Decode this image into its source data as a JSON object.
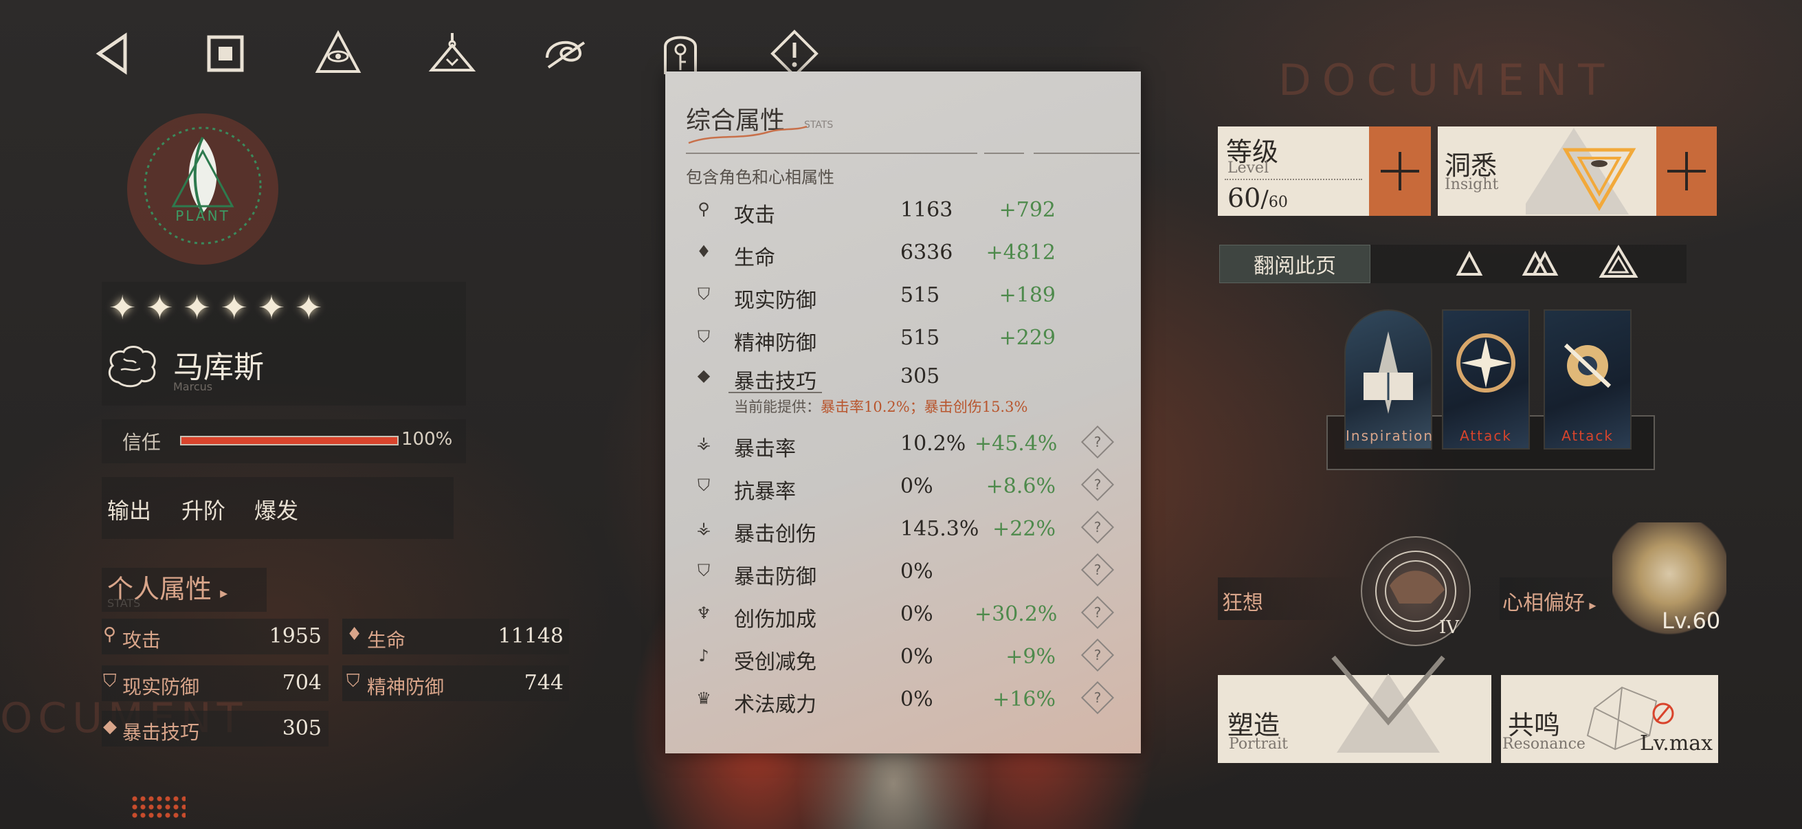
{
  "background": {
    "watermark_right": "DOCUMENT",
    "watermark_left": "OCUMENT"
  },
  "nav": {
    "icons": [
      "back-triangle-icon",
      "stop-square-icon",
      "eye-triangle-icon",
      "flask-icon",
      "swirl-icon",
      "key-door-icon",
      "warning-diamond-icon"
    ]
  },
  "character": {
    "stars": "✦✦✦✦✦✦",
    "name": "马库斯",
    "name_en": "Marcus",
    "afflatus": "PLANT",
    "trust_label": "信任",
    "trust_value": "100%",
    "trust_fraction": 1.0,
    "tags": [
      "输出",
      "升阶",
      "爆发"
    ]
  },
  "personal": {
    "title": "个人属性",
    "title_en": "STATS",
    "stats": [
      {
        "label": "攻击",
        "value": "1955",
        "icon": "attack-icon"
      },
      {
        "label": "生命",
        "value": "11148",
        "icon": "health-icon"
      },
      {
        "label": "现实防御",
        "value": "704",
        "icon": "reality-def-icon"
      },
      {
        "label": "精神防御",
        "value": "744",
        "icon": "mental-def-icon"
      },
      {
        "label": "暴击技巧",
        "value": "305",
        "icon": "crit-tech-icon"
      }
    ]
  },
  "stats_popup": {
    "title": "综合属性",
    "title_en": "STATS",
    "desc": "包含角色和心相属性",
    "rows": [
      {
        "label": "攻击",
        "base": "1163",
        "bonus": "+792",
        "help": false
      },
      {
        "label": "生命",
        "base": "6336",
        "bonus": "+4812",
        "help": false
      },
      {
        "label": "现实防御",
        "base": "515",
        "bonus": "+189",
        "help": false
      },
      {
        "label": "精神防御",
        "base": "515",
        "bonus": "+229",
        "help": false
      },
      {
        "label": "暴击技巧",
        "base": "305",
        "bonus": "",
        "help": false
      },
      {
        "label": "暴击率",
        "base": "10.2%",
        "bonus": "+45.4%",
        "help": true
      },
      {
        "label": "抗暴率",
        "base": "0%",
        "bonus": "+8.6%",
        "help": true
      },
      {
        "label": "暴击创伤",
        "base": "145.3%",
        "bonus": "+22%",
        "help": true
      },
      {
        "label": "暴击防御",
        "base": "0%",
        "bonus": "",
        "help": true
      },
      {
        "label": "创伤加成",
        "base": "0%",
        "bonus": "+30.2%",
        "help": true
      },
      {
        "label": "受创减免",
        "base": "0%",
        "bonus": "+9%",
        "help": true
      },
      {
        "label": "术法威力",
        "base": "0%",
        "bonus": "+16%",
        "help": true
      }
    ],
    "crit_note_prefix": "当前能提供：",
    "crit_note_value": "暴击率10.2%；暴击创伤15.3%",
    "help_symbol": "?"
  },
  "level": {
    "label": "等级",
    "label_en": "Level",
    "current": "60",
    "max": "60",
    "separator": "/"
  },
  "insight": {
    "label": "洞悉",
    "label_en": "Insight"
  },
  "browse": {
    "label": "翻阅此页"
  },
  "tarot": {
    "labels": [
      "Inspiration",
      "Attack",
      "Attack"
    ]
  },
  "kuangxiang": {
    "label": "狂想",
    "level": "IV"
  },
  "xinxiang": {
    "label": "心相偏好",
    "level": "Lv.60"
  },
  "portrait": {
    "label": "塑造",
    "label_en": "Portrait"
  },
  "resonance": {
    "label": "共鸣",
    "label_en": "Resonance",
    "level": "Lv.max"
  },
  "colors": {
    "accent": "#c86a3a",
    "trust_bar": "#d9442c",
    "bonus_green": "#4e8a4c",
    "card_bg": "#ece4d6"
  }
}
